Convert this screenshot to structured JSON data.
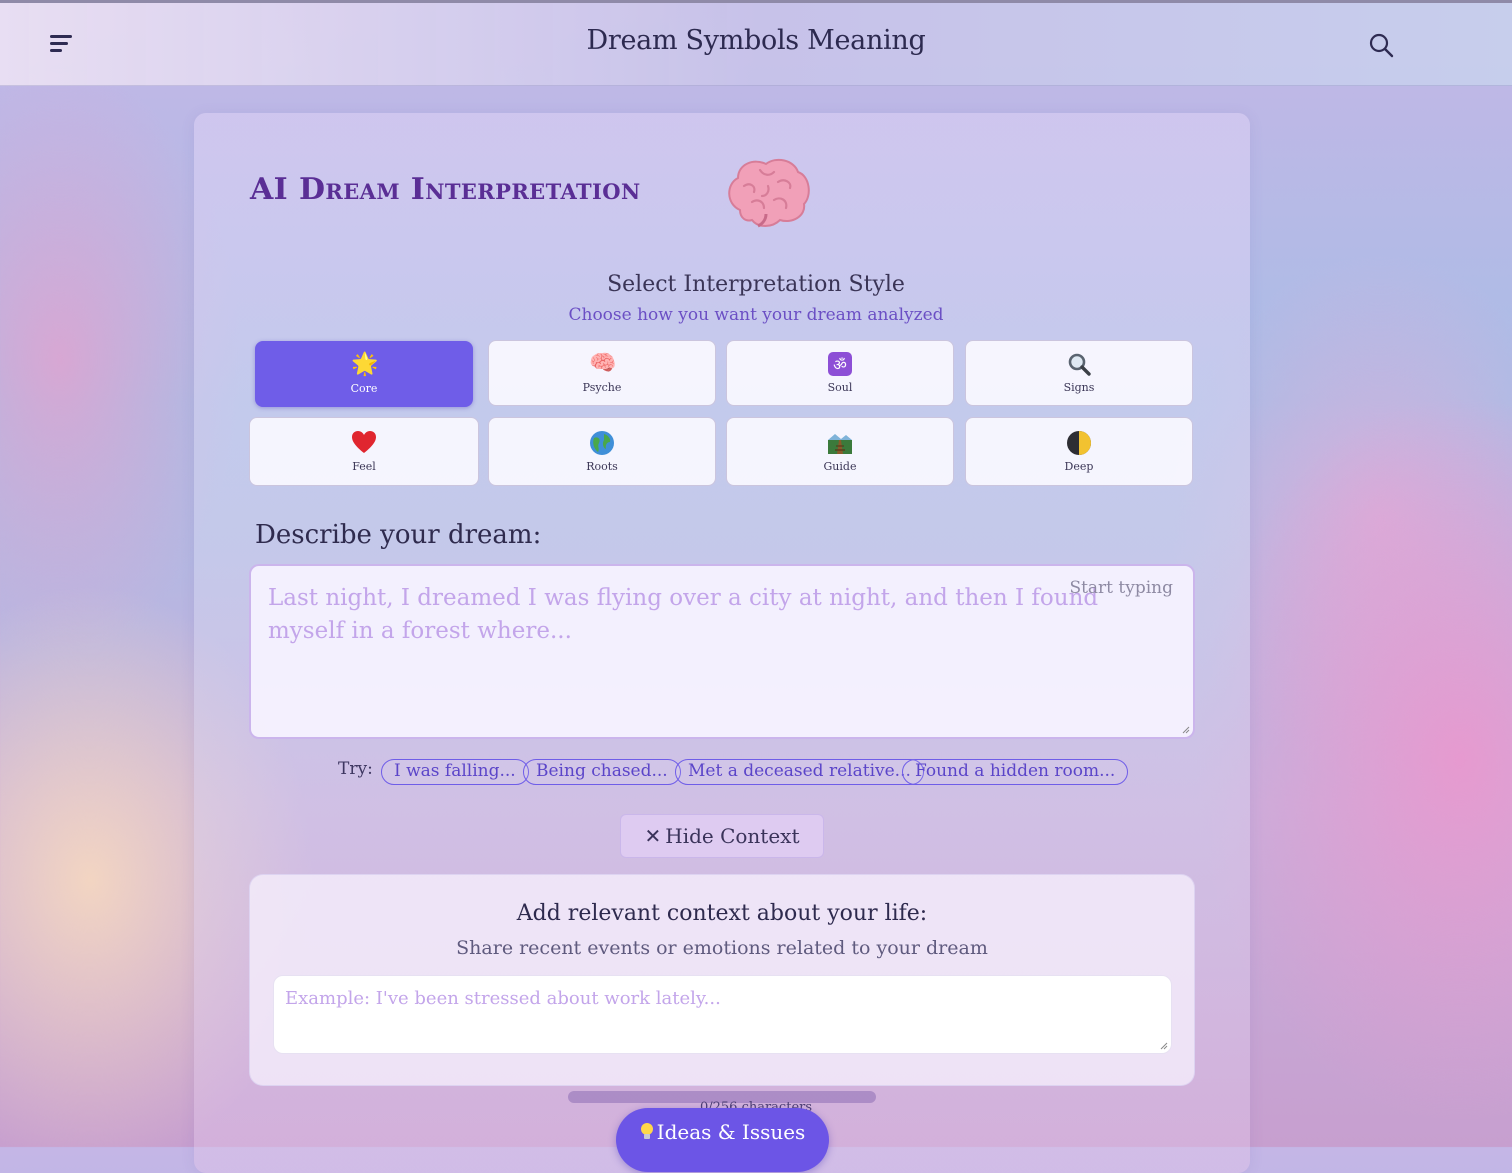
{
  "header": {
    "title": "Dream Symbols Meaning",
    "menu_icon": "hamburger-menu-icon",
    "search_icon": "search-icon"
  },
  "hero": {
    "title": "AI Dream Interpretation",
    "icon": "brain-emoji-icon"
  },
  "style_selector": {
    "title": "Select Interpretation Style",
    "subtitle": "Choose how you want your dream analyzed",
    "selected": "Core",
    "options": [
      {
        "label": "Core",
        "icon": "glowing-star-icon",
        "glyph": "🌟"
      },
      {
        "label": "Psyche",
        "icon": "brain-icon",
        "glyph": "🧠"
      },
      {
        "label": "Soul",
        "icon": "om-icon",
        "glyph": "🕉"
      },
      {
        "label": "Signs",
        "icon": "magnifying-glass-icon",
        "glyph": "🔍"
      },
      {
        "label": "Feel",
        "icon": "heart-icon",
        "glyph": "❤"
      },
      {
        "label": "Roots",
        "icon": "globe-icon",
        "glyph": "🌍"
      },
      {
        "label": "Guide",
        "icon": "railway-track-icon",
        "glyph": "🛤"
      },
      {
        "label": "Deep",
        "icon": "moon-phase-icon",
        "glyph": "🌓"
      }
    ]
  },
  "dream_input": {
    "label": "Describe your dream:",
    "placeholder": "Last night, I dreamed I was flying over a city at night, and then I found myself in a forest where...",
    "hint": "Start typing",
    "value": ""
  },
  "suggestions": {
    "label": "Try:",
    "chips": [
      "I was falling...",
      "Being chased...",
      "Met a deceased relative...",
      "Found a hidden room..."
    ]
  },
  "context_toggle": {
    "icon": "close-icon",
    "label": "Hide Context"
  },
  "context_panel": {
    "title": "Add relevant context about your life:",
    "subtitle": "Share recent events or emotions related to your dream",
    "placeholder": "Example: I've been stressed about work lately...",
    "value": ""
  },
  "char_counter": {
    "text": "0/256 characters"
  },
  "feedback_button": {
    "icon": "lightbulb-icon",
    "label": "Ideas & Issues"
  },
  "colors": {
    "accent": "#6f5de8",
    "title_purple": "#5a2e95",
    "placeholder": "#c3a5ea"
  }
}
